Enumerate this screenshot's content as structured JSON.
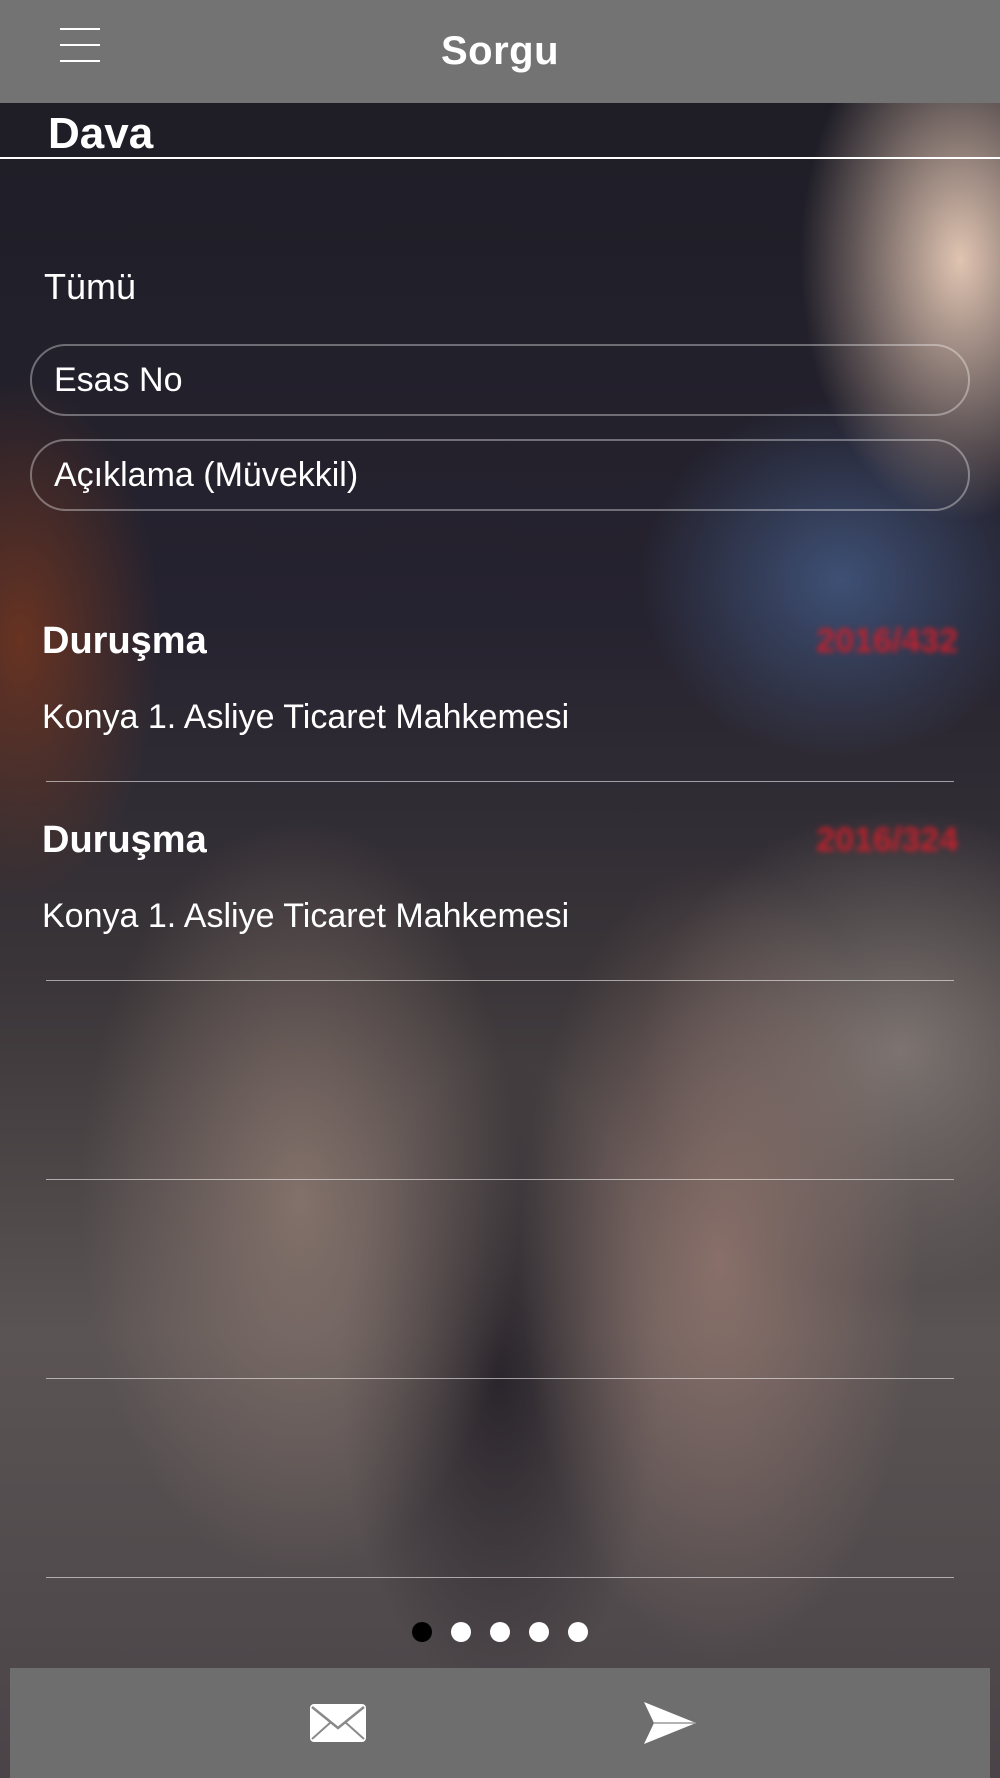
{
  "header": {
    "title": "Sorgu",
    "menu_icon": "hamburger-menu-icon"
  },
  "section": {
    "label": "Dava"
  },
  "filters": {
    "all_label": "Tümü",
    "esas_no_placeholder": "Esas No",
    "aciklama_placeholder": "Açıklama (Müvekkil)"
  },
  "list": {
    "items": [
      {
        "type": "Duruşma",
        "ref": "2016/432",
        "court": "Konya 1. Asliye Ticaret Mahkemesi"
      },
      {
        "type": "Duruşma",
        "ref": "2016/324",
        "court": "Konya 1. Asliye Ticaret Mahkemesi"
      },
      {
        "type": "",
        "ref": "",
        "court": ""
      },
      {
        "type": "",
        "ref": "",
        "court": ""
      },
      {
        "type": "",
        "ref": "",
        "court": ""
      }
    ]
  },
  "pagination": {
    "pages": 5,
    "current": 1
  },
  "bottom_bar": {
    "mail_icon": "envelope-icon",
    "send_icon": "send-arrow-icon"
  },
  "colors": {
    "topbar_bg": "#737373",
    "bottombar_bg": "#6e6e6e",
    "ref_red": "#c4202c",
    "text": "#ffffff"
  }
}
